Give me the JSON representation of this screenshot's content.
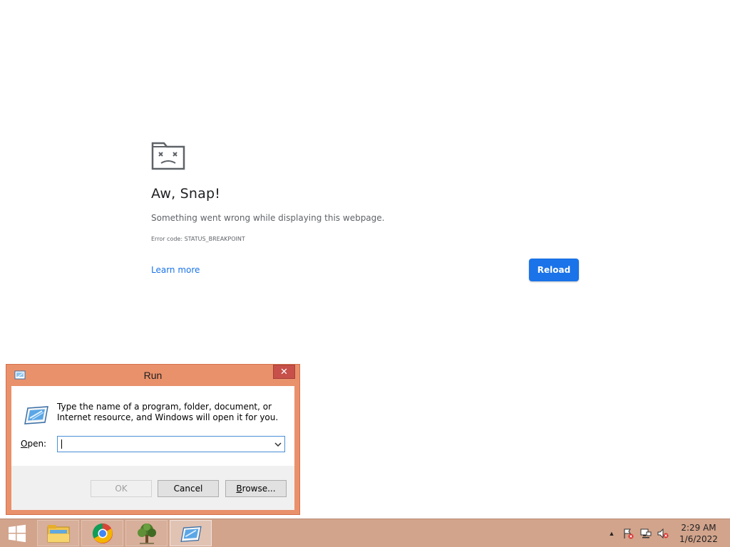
{
  "crash_page": {
    "icon": "sad-tab-icon",
    "title": "Aw, Snap!",
    "message": "Something went wrong while displaying this webpage.",
    "error_code": "Error code: STATUS_BREAKPOINT",
    "learn_more": "Learn more",
    "reload": "Reload",
    "accent_color": "#1a73e8"
  },
  "run_dialog": {
    "title": "Run",
    "close_icon": "close-icon",
    "description": "Type the name of a program, folder, document, or Internet resource, and Windows will open it for you.",
    "open_label_accel": "O",
    "open_label_rest": "pen:",
    "open_value": "",
    "ok": "OK",
    "cancel": "Cancel",
    "browse_accel": "B",
    "browse_rest": "rowse...",
    "frame_color": "#e9916b"
  },
  "taskbar": {
    "apps": [
      {
        "name": "File Explorer",
        "icon": "folder-icon"
      },
      {
        "name": "Google Chrome",
        "icon": "chrome-icon"
      },
      {
        "name": "Tree app",
        "icon": "tree-icon"
      },
      {
        "name": "Run",
        "icon": "run-icon",
        "active": true
      }
    ],
    "tray": [
      "chevron-up-icon",
      "flag-icon",
      "network-icon",
      "volume-muted-icon"
    ],
    "time": "2:29 AM",
    "date": "1/6/2022",
    "color": "#d2a48c"
  }
}
